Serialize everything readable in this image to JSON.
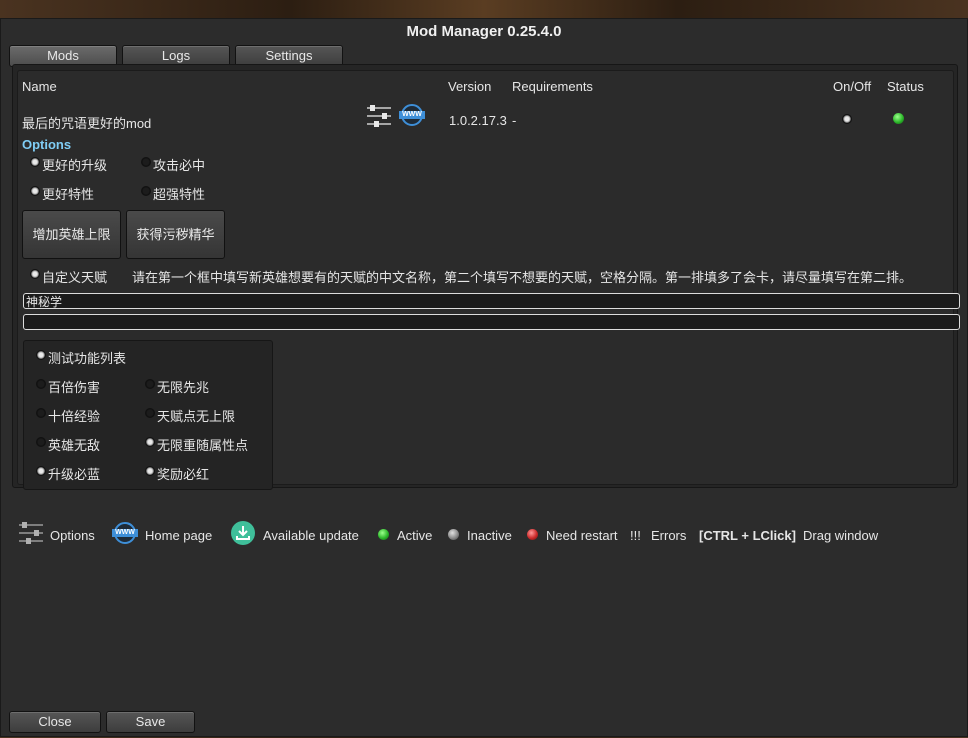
{
  "window": {
    "title": "Mod Manager 0.25.4.0"
  },
  "tabs": [
    "Mods",
    "Logs",
    "Settings"
  ],
  "table": {
    "headers": {
      "name": "Name",
      "version": "Version",
      "requirements": "Requirements",
      "onoff": "On/Off",
      "status": "Status"
    },
    "mod": {
      "name": "最后的咒语更好的mod",
      "version": "1.0.2.17.3",
      "requirements": "-",
      "enabled": true,
      "status_color": "#2db82b"
    }
  },
  "options": {
    "label": "Options",
    "row1": [
      {
        "label": "更好的升级",
        "checked": true
      },
      {
        "label": "攻击必中",
        "checked": false
      }
    ],
    "row2": [
      {
        "label": "更好特性",
        "checked": true
      },
      {
        "label": "超强特性",
        "checked": false
      }
    ],
    "buttons": [
      "增加英雄上限",
      "获得污秽精华"
    ],
    "custom_talent": {
      "label": "自定义天赋",
      "checked": true
    },
    "instruction": "请在第一个框中填写新英雄想要有的天赋的中文名称，第二个填写不想要的天赋，空格分隔。第一排填多了会卡，请尽量填写在第二排。",
    "field1_value": "神秘学",
    "field2_value": "",
    "test_list": {
      "label": "测试功能列表",
      "checked": true,
      "items": [
        {
          "label": "百倍伤害",
          "checked": false
        },
        {
          "label": "无限先兆",
          "checked": false
        },
        {
          "label": "十倍经验",
          "checked": false
        },
        {
          "label": "天赋点无上限",
          "checked": false
        },
        {
          "label": "英雄无敌",
          "checked": false
        },
        {
          "label": "无限重随属性点",
          "checked": true
        },
        {
          "label": "升级必蓝",
          "checked": true
        },
        {
          "label": "奖励必红",
          "checked": true
        }
      ]
    }
  },
  "legend": {
    "options": "Options",
    "home_page": "Home page",
    "www_icon_text": "WWW",
    "available_update": "Available update",
    "active": "Active",
    "inactive": "Inactive",
    "need_restart": "Need restart",
    "errors_symbol": "!!!",
    "errors": "Errors",
    "shortcut": "[CTRL + LClick]",
    "drag_window": "Drag window"
  },
  "footer": {
    "close": "Close",
    "save": "Save"
  },
  "colors": {
    "accent_options": "#7fcdf5",
    "active": "#2db82b",
    "inactive": "#8a8a8a",
    "restart": "#cc2a2a",
    "link_icon": "#3e8fd8"
  }
}
